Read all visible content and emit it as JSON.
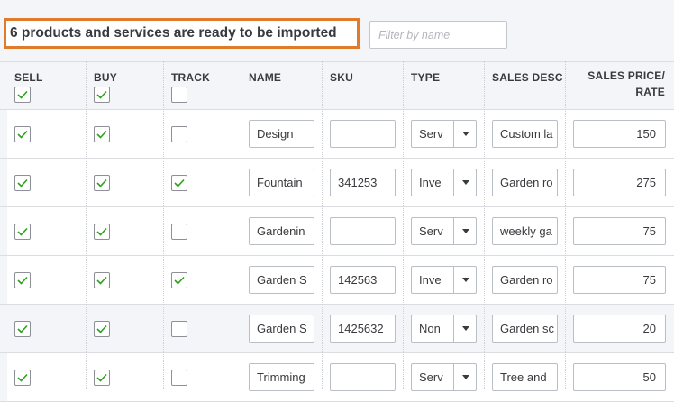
{
  "banner": {
    "text": "6 products and services are ready to be imported"
  },
  "filter": {
    "placeholder": "Filter by name"
  },
  "columns": {
    "sell": "SELL",
    "buy": "BUY",
    "track": "TRACK",
    "name": "NAME",
    "sku": "SKU",
    "type": "TYPE",
    "sales_desc": "SALES DESC",
    "sales_price_line1": "SALES PRICE/",
    "sales_price_line2": "RATE"
  },
  "header_checks": {
    "sell": true,
    "buy": true,
    "track": false
  },
  "rows": [
    {
      "sell": true,
      "buy": true,
      "track": false,
      "name": "Design",
      "sku": "",
      "type": "Serv",
      "sales_desc": "Custom la",
      "price": "150",
      "shaded": false
    },
    {
      "sell": true,
      "buy": true,
      "track": true,
      "name": "Fountain",
      "sku": "341253",
      "type": "Inve",
      "sales_desc": "Garden ro",
      "price": "275",
      "shaded": false
    },
    {
      "sell": true,
      "buy": true,
      "track": false,
      "name": "Gardenin",
      "sku": "",
      "type": "Serv",
      "sales_desc": "weekly ga",
      "price": "75",
      "shaded": false
    },
    {
      "sell": true,
      "buy": true,
      "track": true,
      "name": "Garden S",
      "sku": "142563",
      "type": "Inve",
      "sales_desc": "Garden ro",
      "price": "75",
      "shaded": false
    },
    {
      "sell": true,
      "buy": true,
      "track": false,
      "name": "Garden S",
      "sku": "1425632",
      "type": "Non",
      "sales_desc": "Garden sc",
      "price": "20",
      "shaded": true
    },
    {
      "sell": true,
      "buy": true,
      "track": false,
      "name": "Trimming",
      "sku": "",
      "type": "Serv",
      "sales_desc": "Tree and",
      "price": "50",
      "shaded": false
    }
  ],
  "colors": {
    "highlight_border": "#e07b2b",
    "check": "#2ca01c"
  }
}
